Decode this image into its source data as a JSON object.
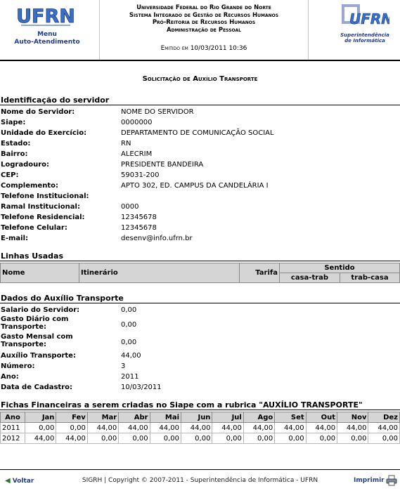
{
  "header": {
    "logo_text": "UFRN",
    "menu_label": "Menu",
    "auto_label": "Auto-Atendimento",
    "lines": [
      "Universidade Federal do Rio Grande do Norte",
      "Sistema Integrado de Gestão de Recursos Humanos",
      "Pró-Reitoria de Recursos Humanos",
      "Administração de Pessoal"
    ],
    "emitido": "Emitido em 10/03/2011 10:36",
    "sinfo_logo": "UFRN",
    "sinfo_line1": "Superintendência",
    "sinfo_line2": "de Informática"
  },
  "title": "Solicitação de Auxílio Transporte",
  "identificacao": {
    "section_title": "Identificação do servidor",
    "rows": [
      {
        "label": "Nome do Servidor:",
        "value": "NOME DO SERVIDOR"
      },
      {
        "label": "Siape:",
        "value": "0000000"
      },
      {
        "label": "Unidade do Exercício:",
        "value": "DEPARTAMENTO DE COMUNICAÇÃO SOCIAL"
      },
      {
        "label": "Estado:",
        "value": "RN"
      },
      {
        "label": "Bairro:",
        "value": "ALECRIM"
      },
      {
        "label": "Logradouro:",
        "value": "PRESIDENTE BANDEIRA"
      },
      {
        "label": "CEP:",
        "value": "59031-200"
      },
      {
        "label": "Complemento:",
        "value": "APTO 302, ED. CAMPUS DA CANDELÁRIA I"
      },
      {
        "label": "Telefone Institucional:",
        "value": ""
      },
      {
        "label": "Ramal Institucional:",
        "value": "0000"
      },
      {
        "label": "Telefone Residencial:",
        "value": "12345678"
      },
      {
        "label": "Telefone Celular:",
        "value": "12345678"
      },
      {
        "label": "E-mail:",
        "value": "desenv@info.ufrn.br"
      }
    ]
  },
  "linhas": {
    "section_title": "Linhas Usadas",
    "col_nome": "Nome",
    "col_itinerario": "Itinerário",
    "col_tarifa": "Tarifa",
    "col_sentido": "Sentido",
    "col_casa_trab": "casa-trab",
    "col_trab_casa": "trab-casa"
  },
  "auxilio": {
    "section_title": "Dados do Auxílio Transporte",
    "rows": [
      {
        "label": "Salario do Servidor:",
        "value": "0,00"
      },
      {
        "label": "Gasto Diário com Transporte:",
        "value": "0,00"
      },
      {
        "label": "Gasto Mensal com Transporte:",
        "value": "0,00"
      },
      {
        "label": "Auxílio Transporte:",
        "value": "44,00"
      },
      {
        "label": "Número:",
        "value": "3"
      },
      {
        "label": "Ano:",
        "value": "2011"
      },
      {
        "label": "Data de Cadastro:",
        "value": "10/03/2011"
      }
    ]
  },
  "fichas": {
    "section_title": "Fichas Financeiras a serem criadas no Siape com a rubrica \"AUXÍLIO TRANSPORTE\"",
    "headers": [
      "Ano",
      "Jan",
      "Fev",
      "Mar",
      "Abr",
      "Mai",
      "Jun",
      "Jul",
      "Ago",
      "Set",
      "Out",
      "Nov",
      "Dez"
    ],
    "rows": [
      [
        "2011",
        "0,00",
        "0,00",
        "44,00",
        "44,00",
        "44,00",
        "44,00",
        "44,00",
        "44,00",
        "44,00",
        "44,00",
        "44,00",
        "44,00"
      ],
      [
        "2012",
        "44,00",
        "44,00",
        "0,00",
        "0,00",
        "0,00",
        "0,00",
        "0,00",
        "0,00",
        "0,00",
        "0,00",
        "0,00",
        "0,00"
      ]
    ]
  },
  "footer": {
    "voltar": "Voltar",
    "copyright": "SIGRH | Copyright © 2007-2011 - Superintendência de Informática - UFRN",
    "imprimir": "Imprimir"
  },
  "colors": {
    "brand_blue": "#223c8f",
    "header_gray": "#d5d5d5"
  }
}
